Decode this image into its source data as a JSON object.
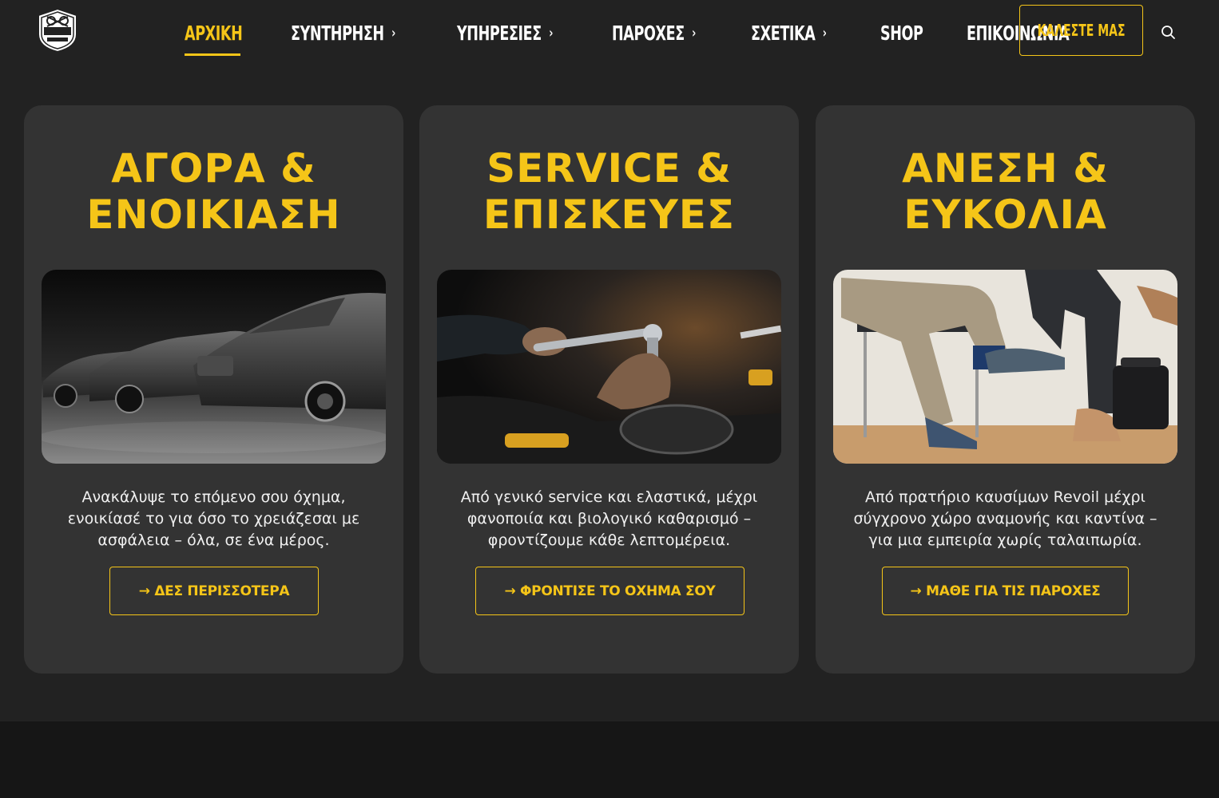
{
  "logo": {
    "alt": "POKO NF GARAGE"
  },
  "nav": {
    "items": [
      {
        "label": "ΑΡΧΙΚΗ",
        "active": true,
        "has_dropdown": false
      },
      {
        "label": "ΣΥΝΤΗΡΗΣΗ",
        "has_dropdown": true
      },
      {
        "label": "ΥΠΗΡΕΣΙΕΣ",
        "has_dropdown": true
      },
      {
        "label": "ΠΑΡΟΧΕΣ",
        "has_dropdown": true
      },
      {
        "label": "ΣΧΕΤΙΚΑ",
        "has_dropdown": true
      },
      {
        "label": "SHOP",
        "has_dropdown": false
      },
      {
        "label": "ΕΠΙΚΟΙΝΩΝΙΑ",
        "has_dropdown": false
      }
    ],
    "chevron": "›"
  },
  "header": {
    "call_label": "ΚΑΛΕΣΤΕ ΜΑΣ"
  },
  "colors": {
    "accent": "#f5c518",
    "bg": "#222222",
    "card": "#333333"
  },
  "cards": [
    {
      "title_line1": "ΑΓΟΡΑ &",
      "title_line2": "ΕΝΟΙΚΙΑΣΗ",
      "image": "luxury-cars-image",
      "text": "Ανακάλυψε το επόμενο σου όχημα, ενοικίασέ το για όσο το χρειάζεσαι με ασφάλεια – όλα, σε ένα μέρος.",
      "button": "→ ΔΕΣ ΠΕΡΙΣΣΟΤΕΡΑ"
    },
    {
      "title_line1": "SERVICE &",
      "title_line2": "ΕΠΙΣΚΕΥΕΣ",
      "image": "mechanic-wrench-image",
      "text": "Από γενικό service και ελαστικά, μέχρι φανοποιία και βιολογικό καθαρισμό – φροντίζουμε κάθε λεπτομέρεια.",
      "button": "→ ΦΡΟΝΤΙΣΕ ΤΟ ΟΧΗΜΑ ΣΟΥ"
    },
    {
      "title_line1": "ΑΝΕΣΗ &",
      "title_line2": "ΕΥΚΟΛΙΑ",
      "image": "waiting-room-image",
      "text": "Από πρατήριο καυσίμων Revoil μέχρι σύγχρονο χώρο αναμονής και καντίνα – για μια εμπειρία χωρίς ταλαιπωρία.",
      "button": "→ ΜΑΘΕ ΓΙΑ ΤΙΣ ΠΑΡΟΧΕΣ"
    }
  ]
}
